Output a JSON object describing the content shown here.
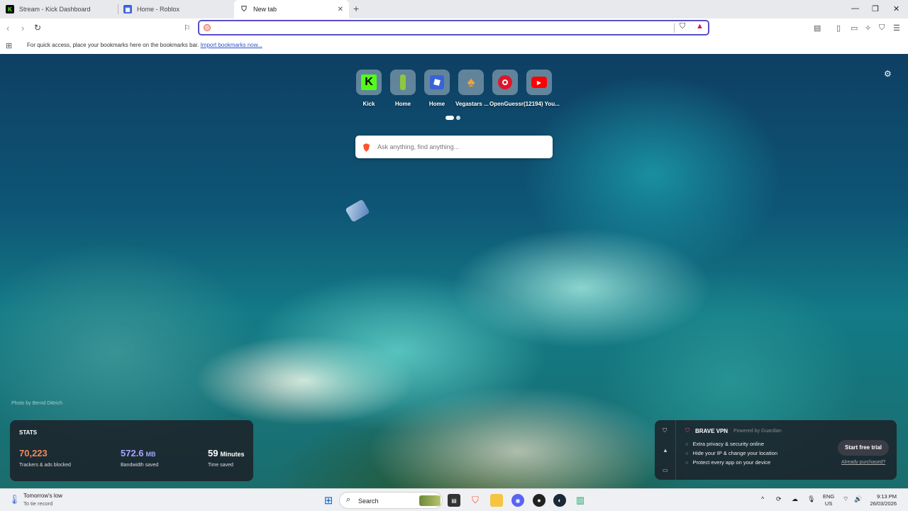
{
  "tabs": [
    {
      "title": "Stream - Kick Dashboard",
      "icon": "kick-icon"
    },
    {
      "title": "Home - Roblox",
      "icon": "roblox-icon"
    },
    {
      "title": "New tab",
      "icon": "brave-icon",
      "active": true
    }
  ],
  "bookmarks_bar": {
    "message": "For quick access, place your bookmarks here on the bookmarks bar.",
    "import_link": "Import bookmarks now..."
  },
  "shortcuts": [
    {
      "label": "Kick",
      "icon": "kick-icon"
    },
    {
      "label": "Home",
      "icon": "home-icon"
    },
    {
      "label": "Home",
      "icon": "roblox-icon"
    },
    {
      "label": "Vegastars ...",
      "icon": "vegastars-icon"
    },
    {
      "label": "OpenGuessr",
      "icon": "openguessr-icon"
    },
    {
      "label": "(12194) You...",
      "icon": "youtube-icon"
    }
  ],
  "search": {
    "placeholder": "Ask anything, find anything..."
  },
  "photo_credit": "Photo by Bernd Dittrich",
  "stats": {
    "title": "STATS",
    "trackers": {
      "value": "70,223",
      "label": "Trackers & ads blocked"
    },
    "bandwidth": {
      "value": "572.6",
      "unit": "MB",
      "label": "Bandwidth saved"
    },
    "time": {
      "value": "59",
      "unit": "Minutes",
      "label": "Time saved"
    }
  },
  "vpn": {
    "title": "BRAVE VPN",
    "powered_by": "Powered by Guardian",
    "features": [
      "Extra privacy & security online",
      "Hide your IP & change your location",
      "Protect every app on your device"
    ],
    "cta": "Start free trial",
    "already": "Already purchased?"
  },
  "taskbar": {
    "weather_title": "Tomorrow's low",
    "weather_sub": "To tie record",
    "search_label": "Search",
    "lang_line1": "ENG",
    "lang_line2": "US",
    "time": "9:13 PM",
    "date": "26/03/2026"
  },
  "colors": {
    "accent": "#5b4ec7",
    "trackers": "#f28a5b",
    "bandwidth": "#a7a4ff",
    "time": "#ffffff"
  }
}
